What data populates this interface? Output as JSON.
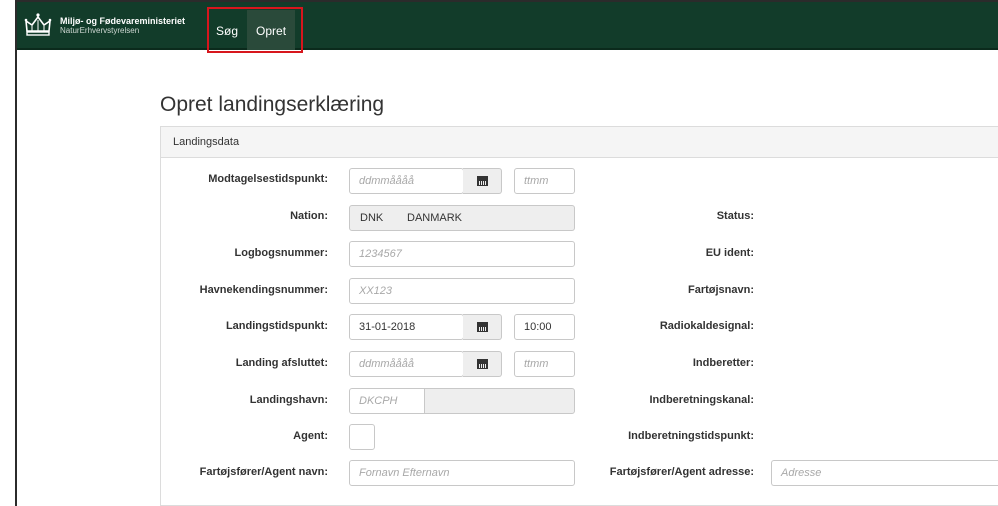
{
  "header": {
    "ministry": "Miljø- og Fødevareministeriet",
    "agency": "NaturErhvervstyrelsen",
    "nav": [
      {
        "label": "Søg"
      },
      {
        "label": "Opret"
      }
    ]
  },
  "page": {
    "title": "Opret landingserklæring"
  },
  "panel": {
    "heading": "Landingsdata"
  },
  "left_fields": {
    "modtagelse": {
      "label": "Modtagelsestidspunkt:",
      "date_placeholder": "ddmmåååå",
      "time_placeholder": "ttmm"
    },
    "nation": {
      "label": "Nation:",
      "code": "DNK",
      "name": "DANMARK"
    },
    "logbog": {
      "label": "Logbogsnummer:",
      "placeholder": "1234567"
    },
    "havnekending": {
      "label": "Havnekendingsnummer:",
      "placeholder": "XX123"
    },
    "landingstid": {
      "label": "Landingstidspunkt:",
      "date_value": "31-01-2018",
      "time_value": "10:00"
    },
    "landing_afsluttet": {
      "label": "Landing afsluttet:",
      "date_placeholder": "ddmmåååå",
      "time_placeholder": "ttmm"
    },
    "landingshavn": {
      "label": "Landingshavn:",
      "placeholder": "DKCPH"
    },
    "agent": {
      "label": "Agent:"
    },
    "forer_navn": {
      "label": "Fartøjsfører/Agent navn:",
      "placeholder": "Fornavn Efternavn"
    }
  },
  "right_fields": {
    "status": {
      "label": "Status:"
    },
    "eu_ident": {
      "label": "EU ident:"
    },
    "fartojsnavn": {
      "label": "Fartøjsnavn:"
    },
    "radiokald": {
      "label": "Radiokaldesignal:"
    },
    "indberetter": {
      "label": "Indberetter:"
    },
    "kanal": {
      "label": "Indberetningskanal:"
    },
    "indb_tid": {
      "label": "Indberetningstidspunkt:"
    },
    "forer_adresse": {
      "label": "Fartøjsfører/Agent adresse:",
      "placeholder": "Adresse"
    }
  },
  "colors": {
    "navbar": "#123c2a",
    "highlight": "#d7161d"
  }
}
